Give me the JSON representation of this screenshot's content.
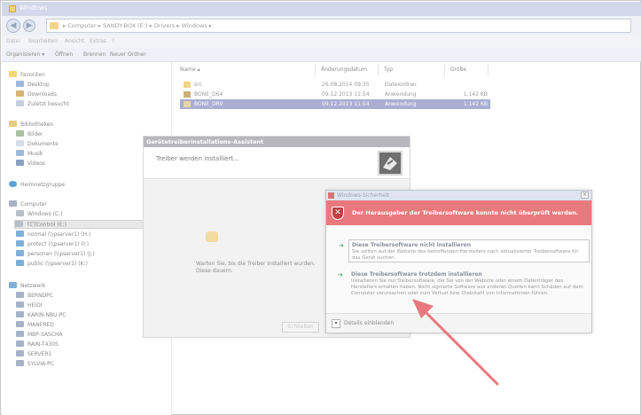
{
  "window": {
    "title": "Windows"
  },
  "addressbar": {
    "path": "▸ Computer ▸ SANDY-BOX (E:) ▸ Drivers ▸ Windows ▸"
  },
  "menubar": {
    "items": [
      "Datei",
      "Bearbeiten",
      "Ansicht",
      "Extras",
      "?"
    ]
  },
  "toolbar": {
    "organize": "Organisieren ▾",
    "open": "Öffnen",
    "burn": "Brennen",
    "new_folder": "Neuer Ordner"
  },
  "sidebar": {
    "favorites": "Favoriten",
    "desktop": "Desktop",
    "downloads": "Downloads",
    "recent": "Zuletzt besucht",
    "libraries": "Bibliotheken",
    "pictures": "Bilder",
    "documents": "Dokumente",
    "music": "Musik",
    "videos": "Videos",
    "homegroup": "Heimnetzgruppe",
    "computer": "Computer",
    "drive_c": "Windows (C:)",
    "drive_tct": "TCTControl",
    "drive_tct_letter": "(E:)",
    "normal": "normal (\\\\pserver1) (H:)",
    "protect": "protect (\\\\pserver1) (I:)",
    "personen": "personen (\\\\pserver1) (J:)",
    "public": "public (\\\\pserver1) (K:)",
    "network": "Netzwerk",
    "net_items": [
      "BERNDPC",
      "HEIDI",
      "KARIN-NBU-PC",
      "MANFRED",
      "MBP-SASCHA",
      "RAIN-T430S",
      "SERVER1",
      "SYLVIA-PC"
    ]
  },
  "filelist": {
    "headers": {
      "name": "Name ▴",
      "date": "Änderungsdatum",
      "type": "Typ",
      "size": "Größe"
    },
    "rows": [
      {
        "name": "src",
        "date": "26.08.2014 09:35",
        "type": "Dateiordner",
        "size": ""
      },
      {
        "name": "BONE_D64",
        "date": "09.12.2013 11:54",
        "type": "Anwendung",
        "size": "1.142 KB"
      },
      {
        "name": "BONE_DRV",
        "date": "09.12.2013 11:54",
        "type": "Anwendung",
        "size": "1.142 KB"
      }
    ]
  },
  "installer": {
    "title": "Gerätetreiberinstallations-Assistent",
    "header": "Treiber werden installiert...",
    "wait_text": "Warten Sie, bis die Treiber installiert wurden. Diese dauern.",
    "button": "Schließen"
  },
  "security": {
    "title": "Windows-Sicherheit",
    "close": "x",
    "warning": "Der Herausgeber der Treibersoftware konnte nicht überprüft werden.",
    "opt1_title": "Diese Treibersoftware nicht installieren",
    "opt1_desc": "Sie sollten auf der Website des betreffenden Herstellers nach aktualisierter Treibersoftware für das Gerät suchen.",
    "opt2_title": "Diese Treibersoftware trotzdem installieren",
    "opt2_desc": "Installieren Sie nur Treibersoftware, die Sie von der Website oder einem Datenträger des Herstellers erhalten haben. Nicht signierte Software aus anderen Quellen kann Schäden auf dem Computer verursachen oder zum Verlust bzw. Diebstahl von Informationen führen.",
    "details": "Details einblenden"
  },
  "colors": {
    "warning_red": "#e87a7d",
    "selection": "#a9aed2",
    "pointer": "#e8787e"
  }
}
